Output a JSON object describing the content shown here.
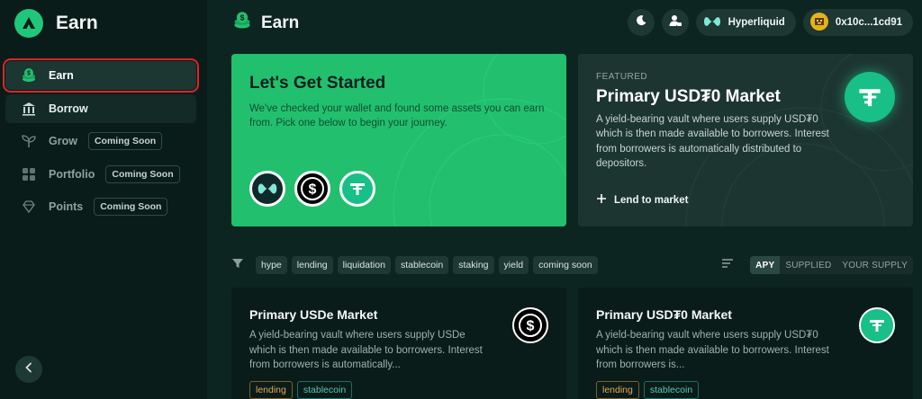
{
  "sidebar": {
    "brand": "Earn",
    "items": [
      {
        "label": "Earn",
        "icon": "coins-icon"
      },
      {
        "label": "Borrow",
        "icon": "bank-icon"
      },
      {
        "label": "Grow",
        "icon": "sprout-icon",
        "badge": "Coming Soon"
      },
      {
        "label": "Portfolio",
        "icon": "grid-icon",
        "badge": "Coming Soon"
      },
      {
        "label": "Points",
        "icon": "diamond-icon",
        "badge": "Coming Soon"
      }
    ]
  },
  "header": {
    "title": "Earn",
    "network": "Hyperliquid",
    "wallet": "0x10c...1cd91"
  },
  "hero": {
    "title": "Let's Get Started",
    "text": "We've checked your wallet and found some assets you can earn from. Pick one below to begin your journey."
  },
  "featured": {
    "label": "FEATURED",
    "title": "Primary USD₮0 Market",
    "text": "A yield-bearing vault where users supply USD₮0 which is then made available to borrowers. Interest from borrowers is automatically distributed to depositors.",
    "link": "Lend to market"
  },
  "filters": {
    "tags": [
      "hype",
      "lending",
      "liquidation",
      "stablecoin",
      "staking",
      "yield",
      "coming soon"
    ],
    "sort": [
      "APY",
      "SUPPLIED",
      "YOUR SUPPLY"
    ],
    "active_sort": "APY"
  },
  "markets": [
    {
      "title": "Primary USDe Market",
      "text": "A yield-bearing vault where users supply USDe which is then made available to borrowers. Interest from borrowers is automatically...",
      "tags": [
        "lending",
        "stablecoin"
      ],
      "icon": "usde-coin-icon"
    },
    {
      "title": "Primary USD₮0 Market",
      "text": "A yield-bearing vault where users supply USD₮0 which is then made available to borrowers. Interest from borrowers is...",
      "tags": [
        "lending",
        "stablecoin"
      ],
      "icon": "usdt0-coin-icon"
    }
  ],
  "colors": {
    "accent": "#22c06e",
    "background": "#0d2521",
    "sidebar": "#0a1c19",
    "highlight": "#e0242a"
  }
}
